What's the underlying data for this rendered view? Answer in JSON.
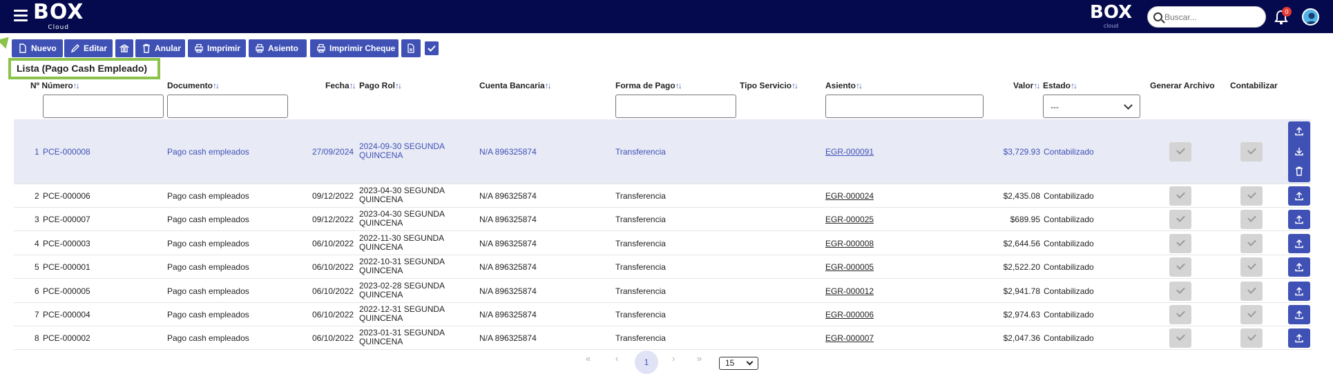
{
  "header": {
    "logo_text": "BOX",
    "logo_sub": "Cloud",
    "logo2_text": "BOX",
    "logo2_sub": "cloud",
    "search_placeholder": "Buscar...",
    "notif_count": "0"
  },
  "toolbar": {
    "nuevo": "Nuevo",
    "editar": "Editar",
    "anular": "Anular",
    "imprimir": "Imprimir",
    "asiento": "Asiento",
    "imprimir_cheque": "Imprimir Cheque"
  },
  "list_title": "Lista (Pago Cash Empleado)",
  "columns": {
    "numero": "Nº Número",
    "documento": "Documento",
    "fecha": "Fecha",
    "pago_rol": "Pago Rol",
    "cuenta": "Cuenta Bancaria",
    "forma_pago": "Forma de Pago",
    "tipo_servicio": "Tipo Servicio",
    "asiento": "Asiento",
    "valor": "Valor",
    "estado": "Estado",
    "generar": "Generar Archivo",
    "contabilizar": "Contabilizar"
  },
  "sort_glyph": "↑↓",
  "estado_filter": "---",
  "rows": [
    {
      "n": "1",
      "numero": "PCE-000008",
      "documento": "Pago cash empleados",
      "fecha": "27/09/2024",
      "pago_rol": "2024-09-30 SEGUNDA QUINCENA",
      "cuenta": "N/A 896325874",
      "forma": "Transferencia",
      "asiento": "EGR-000091",
      "valor": "$3,729.93",
      "estado": "Contabilizado"
    },
    {
      "n": "2",
      "numero": "PCE-000006",
      "documento": "Pago cash empleados",
      "fecha": "09/12/2022",
      "pago_rol": "2023-04-30 SEGUNDA QUINCENA",
      "cuenta": "N/A 896325874",
      "forma": "Transferencia",
      "asiento": "EGR-000024",
      "valor": "$2,435.08",
      "estado": "Contabilizado"
    },
    {
      "n": "3",
      "numero": "PCE-000007",
      "documento": "Pago cash empleados",
      "fecha": "09/12/2022",
      "pago_rol": "2023-04-30 SEGUNDA QUINCENA",
      "cuenta": "N/A 896325874",
      "forma": "Transferencia",
      "asiento": "EGR-000025",
      "valor": "$689.95",
      "estado": "Contabilizado"
    },
    {
      "n": "4",
      "numero": "PCE-000003",
      "documento": "Pago cash empleados",
      "fecha": "06/10/2022",
      "pago_rol": "2022-11-30 SEGUNDA QUINCENA",
      "cuenta": "N/A 896325874",
      "forma": "Transferencia",
      "asiento": "EGR-000008",
      "valor": "$2,644.56",
      "estado": "Contabilizado"
    },
    {
      "n": "5",
      "numero": "PCE-000001",
      "documento": "Pago cash empleados",
      "fecha": "06/10/2022",
      "pago_rol": "2022-10-31 SEGUNDA QUINCENA",
      "cuenta": "N/A 896325874",
      "forma": "Transferencia",
      "asiento": "EGR-000005",
      "valor": "$2,522.20",
      "estado": "Contabilizado"
    },
    {
      "n": "6",
      "numero": "PCE-000005",
      "documento": "Pago cash empleados",
      "fecha": "06/10/2022",
      "pago_rol": "2023-02-28 SEGUNDA QUINCENA",
      "cuenta": "N/A 896325874",
      "forma": "Transferencia",
      "asiento": "EGR-000012",
      "valor": "$2,941.78",
      "estado": "Contabilizado"
    },
    {
      "n": "7",
      "numero": "PCE-000004",
      "documento": "Pago cash empleados",
      "fecha": "06/10/2022",
      "pago_rol": "2022-12-31 SEGUNDA QUINCENA",
      "cuenta": "N/A 896325874",
      "forma": "Transferencia",
      "asiento": "EGR-000006",
      "valor": "$2,974.63",
      "estado": "Contabilizado"
    },
    {
      "n": "8",
      "numero": "PCE-000002",
      "documento": "Pago cash empleados",
      "fecha": "06/10/2022",
      "pago_rol": "2023-01-31 SEGUNDA QUINCENA",
      "cuenta": "N/A 896325874",
      "forma": "Transferencia",
      "asiento": "EGR-000007",
      "valor": "$2,047.36",
      "estado": "Contabilizado"
    }
  ],
  "pagination": {
    "first": "«",
    "prev": "‹",
    "current": "1",
    "next": "›",
    "last": "»",
    "page_size": "15"
  },
  "colors": {
    "topbar": "#050a4e",
    "accent": "#3f51b5",
    "highlight": "#8bc34a",
    "selected_row": "#e8eaf6"
  }
}
